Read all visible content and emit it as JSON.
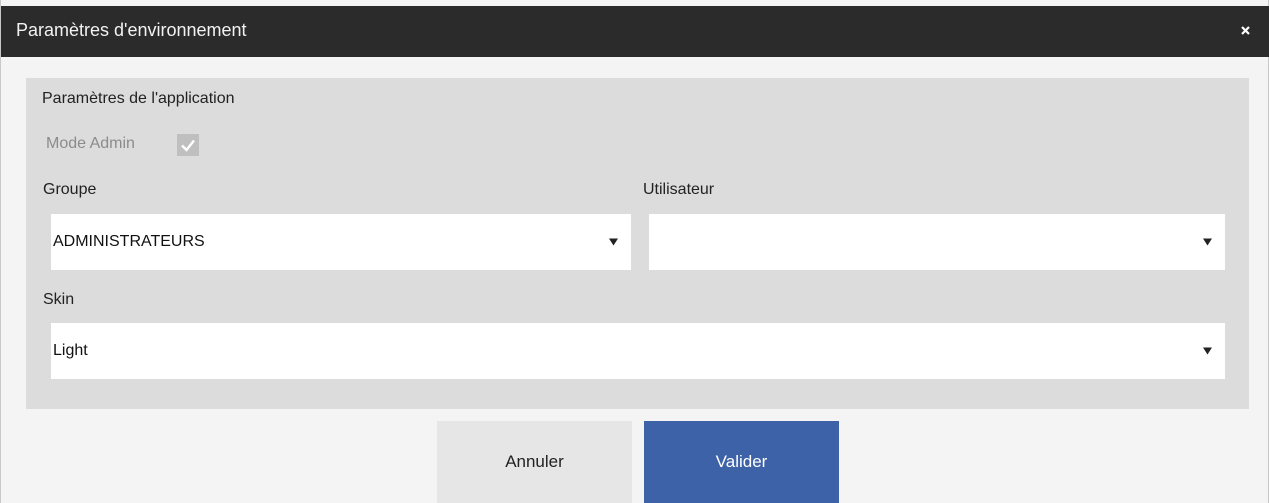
{
  "window": {
    "title": "Paramètres d'environnement",
    "close_icon": "close-icon"
  },
  "app_settings": {
    "section_title": "Paramètres de l'application",
    "admin_mode": {
      "label": "Mode Admin",
      "checked": true,
      "disabled": true
    },
    "group": {
      "label": "Groupe",
      "value": "ADMINISTRATEURS"
    },
    "user": {
      "label": "Utilisateur",
      "value": ""
    },
    "skin": {
      "label": "Skin",
      "value": "Light"
    }
  },
  "buttons": {
    "cancel_label": "Annuler",
    "ok_label": "Valider"
  },
  "colors": {
    "titlebar": "#2b2b2b",
    "panel": "#dcdcdc",
    "primary": "#3d62a8",
    "secondary": "#e6e6e6"
  }
}
